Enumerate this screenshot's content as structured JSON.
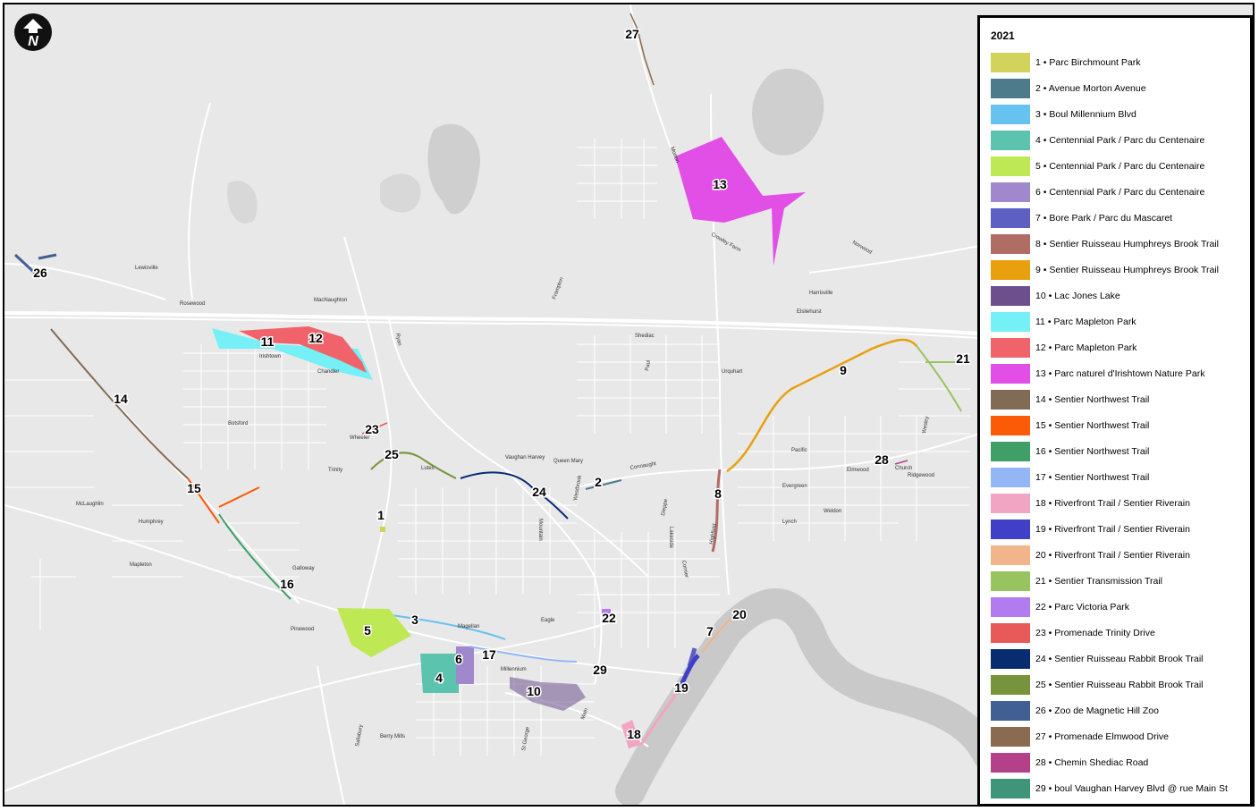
{
  "legend": {
    "year": "2021",
    "items": [
      {
        "id": "1",
        "label": "1 • Parc Birchmount Park",
        "color": "#d1d35a"
      },
      {
        "id": "2",
        "label": "2 • Avenue Morton Avenue",
        "color": "#4e7b8c"
      },
      {
        "id": "3",
        "label": "3 • Boul Millennium Blvd",
        "color": "#66c2ee"
      },
      {
        "id": "4",
        "label": "4 • Centennial Park / Parc du Centenaire",
        "color": "#5cc3ae"
      },
      {
        "id": "5",
        "label": "5 • Centennial Park / Parc du Centenaire",
        "color": "#bfe855"
      },
      {
        "id": "6",
        "label": "6 • Centennial Park / Parc du Centenaire",
        "color": "#9f88cc"
      },
      {
        "id": "7",
        "label": "7 • Bore Park / Parc du Mascaret",
        "color": "#5d5fc2"
      },
      {
        "id": "8",
        "label": "8 • Sentier Ruisseau Humphreys Brook Trail",
        "color": "#b06d64"
      },
      {
        "id": "9",
        "label": "9 • Sentier Ruisseau Humphreys Brook Trail",
        "color": "#e8a00e"
      },
      {
        "id": "10",
        "label": "10 • Lac Jones Lake",
        "color": "#6c4f8c"
      },
      {
        "id": "11",
        "label": "11 • Parc Mapleton Park",
        "color": "#75f0f6"
      },
      {
        "id": "12",
        "label": "12 • Parc Mapleton Park",
        "color": "#f0636b"
      },
      {
        "id": "13",
        "label": "13 • Parc naturel d'Irishtown Nature Park",
        "color": "#e24fe6"
      },
      {
        "id": "14",
        "label": "14 • Sentier Northwest Trail",
        "color": "#826b55"
      },
      {
        "id": "15",
        "label": "15 • Sentier Northwest Trail",
        "color": "#fb5a06"
      },
      {
        "id": "16",
        "label": "16 • Sentier Northwest Trail",
        "color": "#3f9f66"
      },
      {
        "id": "17",
        "label": "17 • Sentier Northwest Trail",
        "color": "#94b5f6"
      },
      {
        "id": "18",
        "label": "18 • Riverfront Trail / Sentier Riverain",
        "color": "#f2a5c2"
      },
      {
        "id": "19",
        "label": "19 • Riverfront Trail / Sentier Riverain",
        "color": "#3f3fc8"
      },
      {
        "id": "20",
        "label": "20 • Riverfront Trail / Sentier Riverain",
        "color": "#f2b48a"
      },
      {
        "id": "21",
        "label": "21 • Sentier Transmission Trail",
        "color": "#98c45f"
      },
      {
        "id": "22",
        "label": "22 • Parc Victoria Park",
        "color": "#b07cf0"
      },
      {
        "id": "23",
        "label": "23 • Promenade Trinity Drive",
        "color": "#e85a5a"
      },
      {
        "id": "24",
        "label": "24 • Sentier Ruisseau Rabbit Brook Trail",
        "color": "#072c70"
      },
      {
        "id": "25",
        "label": "25 • Sentier Ruisseau Rabbit Brook Trail",
        "color": "#77933c"
      },
      {
        "id": "26",
        "label": "26 • Zoo de Magnetic Hill Zoo",
        "color": "#425f94"
      },
      {
        "id": "27",
        "label": "27 • Promenade Elmwood Drive",
        "color": "#8a6b4f"
      },
      {
        "id": "28",
        "label": "28 • Chemin Shediac Road",
        "color": "#b5408a"
      },
      {
        "id": "29",
        "label": "29 • boul Vaughan Harvey Blvd @ rue Main St",
        "color": "#3f9579"
      }
    ]
  },
  "compass": {
    "icon": "north-arrow-icon",
    "letter": "N"
  },
  "map": {
    "site_numbers": [
      "1",
      "2",
      "3",
      "4",
      "5",
      "6",
      "7",
      "8",
      "9",
      "10",
      "11",
      "12",
      "13",
      "14",
      "15",
      "16",
      "17",
      "18",
      "19",
      "20",
      "21",
      "22",
      "23",
      "24",
      "25",
      "26",
      "27",
      "28",
      "29"
    ],
    "street_labels": [
      "Irishtown",
      "Frampton",
      "McLaughlin",
      "Mountain",
      "Connaught",
      "Morton",
      "Elmwood",
      "Shediac",
      "Magellan",
      "Millennium",
      "St George",
      "Main",
      "Vaughan Harvey",
      "Wheeler",
      "Trinity",
      "Ryan",
      "Harrisville",
      "MacNaughton",
      "Elsliehurst",
      "Norwood",
      "Urquhart",
      "Galloway",
      "Queen Mary",
      "Westbrook",
      "Crowley Farm",
      "Dieppe",
      "Cornier",
      "Highfield",
      "Botsford",
      "Lewisville",
      "Mapleton",
      "Salisbury",
      "Berry Mills",
      "Lutes",
      "Ridgewood",
      "Weldon",
      "Church",
      "Wesley",
      "Lakeside",
      "Evergreen",
      "Humphrey",
      "Lynch",
      "Eagle",
      "Paul",
      "Pacific",
      "Pinewood",
      "Rosewood",
      "Chandler"
    ]
  }
}
